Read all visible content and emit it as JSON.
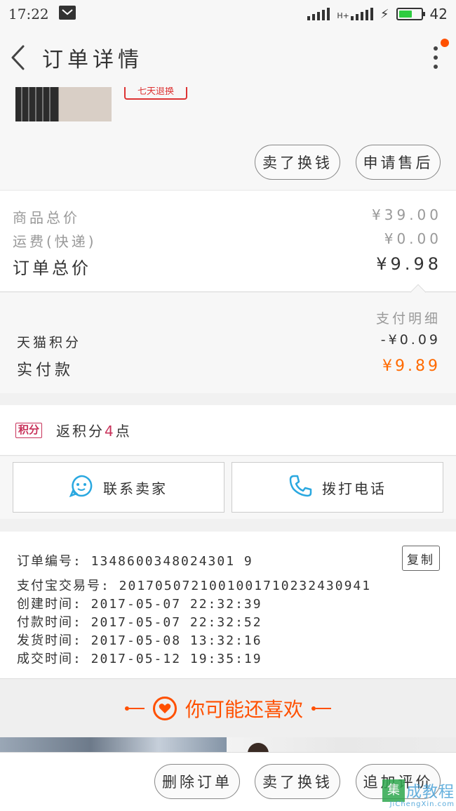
{
  "status_bar": {
    "time": "17:22",
    "network": "H+",
    "battery_level": "42",
    "battery_fraction": 0.62,
    "battery_color": "#2ecc40"
  },
  "header": {
    "title": "订单详情",
    "back_icon": "back-chevron-icon",
    "more_icon": "more-vertical-icon",
    "notice_color": "#ff5000"
  },
  "product": {
    "tag": "七天退换"
  },
  "product_actions": {
    "sell_label": "卖了换钱",
    "after_sale_label": "申请售后"
  },
  "price": {
    "goods_total_label": "商品总价",
    "goods_total_value": "¥39.00",
    "shipping_label": "运费(快递)",
    "shipping_value": "¥0.00",
    "order_total_label": "订单总价",
    "order_total_value": "¥9.98"
  },
  "payment": {
    "detail_link": "支付明细",
    "points_label": "天猫积分",
    "points_value": "-¥0.09",
    "paid_label": "实付款",
    "paid_value": "¥9.89",
    "accent": "#ff6a00"
  },
  "rewards": {
    "badge": "积分",
    "prefix": "返积分",
    "count": "4",
    "suffix": "点"
  },
  "contact": {
    "seller_label": "联系卖家",
    "call_label": "拨打电话"
  },
  "order_info": {
    "order_no": "订单编号: 1348600348024301 9",
    "copy_label": "复制",
    "alipay_no": "支付宝交易号: 2017050721001001710232430941",
    "created": "创建时间: 2017-05-07 22:32:39",
    "paid": "付款时间: 2017-05-07 22:32:52",
    "shipped": "发货时间: 2017-05-08 13:32:16",
    "completed": "成交时间: 2017-05-12 19:35:19"
  },
  "recommend": {
    "title": "你可能还喜欢",
    "icon": "heart-icon",
    "color": "#ff5000"
  },
  "bottom_actions": {
    "delete_label": "删除订单",
    "sell_label": "卖了换钱",
    "review_label": "追加评价"
  },
  "watermark": {
    "logo_char": "集",
    "cn_text": "成教程",
    "url": "JiChengXin.com"
  }
}
